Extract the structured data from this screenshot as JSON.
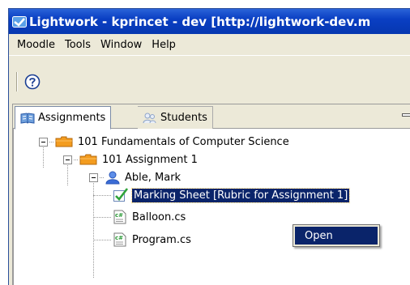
{
  "window": {
    "title": "Lightwork - kprincet - dev [http://lightwork-dev.m"
  },
  "menubar": {
    "items": [
      "Moodle",
      "Tools",
      "Window",
      "Help"
    ]
  },
  "toolbar": {
    "help_icon": "question-mark-circle-icon"
  },
  "tabs": [
    {
      "label": "Assignments",
      "icon": "book-icon",
      "active": true
    },
    {
      "label": "Students",
      "icon": "users-icon",
      "active": false
    }
  ],
  "tree": {
    "course": {
      "label": "101 Fundamentals of Computer Science",
      "icon": "folder-icon"
    },
    "assignment": {
      "label": "101 Assignment 1",
      "icon": "folder-icon"
    },
    "student": {
      "label": "Able, Mark",
      "icon": "user-icon"
    },
    "marking_sheet": {
      "label": "Marking Sheet [Rubric for Assignment 1]",
      "icon": "check-sheet-icon",
      "selected": true
    },
    "files": [
      {
        "label": "Balloon.cs",
        "icon": "csharp-file-icon"
      },
      {
        "label": "Program.cs",
        "icon": "csharp-file-icon"
      }
    ]
  },
  "context_menu": {
    "items": [
      "Open"
    ]
  },
  "colors": {
    "titlebar": "#0a3fc3",
    "selection": "#0a246a",
    "folder": "#f39c1f",
    "user": "#3b6cd6"
  }
}
